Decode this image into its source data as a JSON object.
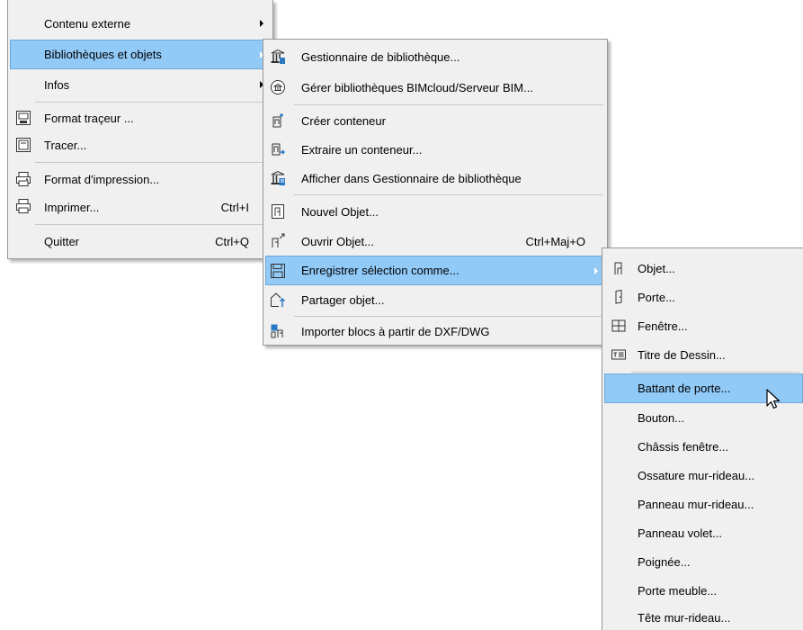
{
  "menu_main": {
    "items": [
      {
        "label": "Contenu externe",
        "submenu": true
      },
      {
        "label": "Bibliothèques et objets",
        "submenu": true,
        "highlighted": true
      },
      {
        "label": "Infos",
        "submenu": true
      },
      {
        "label": "Format traçeur ...",
        "icon": "plotter-setup-icon"
      },
      {
        "label": "Tracer...",
        "icon": "plot-icon"
      },
      {
        "label": "Format d'impression...",
        "icon": "page-setup-icon"
      },
      {
        "label": "Imprimer...",
        "shortcut": "Ctrl+I",
        "icon": "printer-icon"
      },
      {
        "label": "Quitter",
        "shortcut": "Ctrl+Q"
      }
    ]
  },
  "menu_library": {
    "items": [
      {
        "label": "Gestionnaire de bibliothèque...",
        "icon": "library-manager-icon"
      },
      {
        "label": "Gérer bibliothèques BIMcloud/Serveur BIM...",
        "icon": "bimcloud-library-icon"
      },
      {
        "label": "Créer conteneur",
        "icon": "create-container-icon"
      },
      {
        "label": "Extraire un conteneur...",
        "icon": "extract-container-icon"
      },
      {
        "label": "Afficher dans Gestionnaire de bibliothèque",
        "icon": "show-in-library-icon"
      },
      {
        "label": "Nouvel Objet...",
        "icon": "new-object-icon"
      },
      {
        "label": "Ouvrir Objet...",
        "shortcut": "Ctrl+Maj+O",
        "icon": "open-object-icon"
      },
      {
        "label": "Enregistrer sélection comme...",
        "icon": "save-selection-icon",
        "highlighted": true,
        "submenu": true
      },
      {
        "label": "Partager objet...",
        "icon": "share-object-icon"
      },
      {
        "label": "Importer blocs à partir de DXF/DWG",
        "icon": "import-dxf-icon"
      }
    ]
  },
  "menu_save_as": {
    "items": [
      {
        "label": "Objet...",
        "icon": "object-icon"
      },
      {
        "label": "Porte...",
        "icon": "door-icon"
      },
      {
        "label": "Fenêtre...",
        "icon": "window-icon"
      },
      {
        "label": "Titre de Dessin...",
        "icon": "drawing-title-icon"
      },
      {
        "label": "Battant de porte...",
        "highlighted": true
      },
      {
        "label": "Bouton..."
      },
      {
        "label": "Châssis fenêtre..."
      },
      {
        "label": "Ossature mur-rideau..."
      },
      {
        "label": "Panneau mur-rideau..."
      },
      {
        "label": "Panneau volet..."
      },
      {
        "label": "Poignée..."
      },
      {
        "label": "Porte meuble..."
      },
      {
        "label": "Tête mur-rideau..."
      }
    ]
  },
  "colors": {
    "menu_bg": "#f0f0f0",
    "highlight": "#91c9f7",
    "highlight_border": "#6fa7d8",
    "separator": "#c7c7c7"
  }
}
